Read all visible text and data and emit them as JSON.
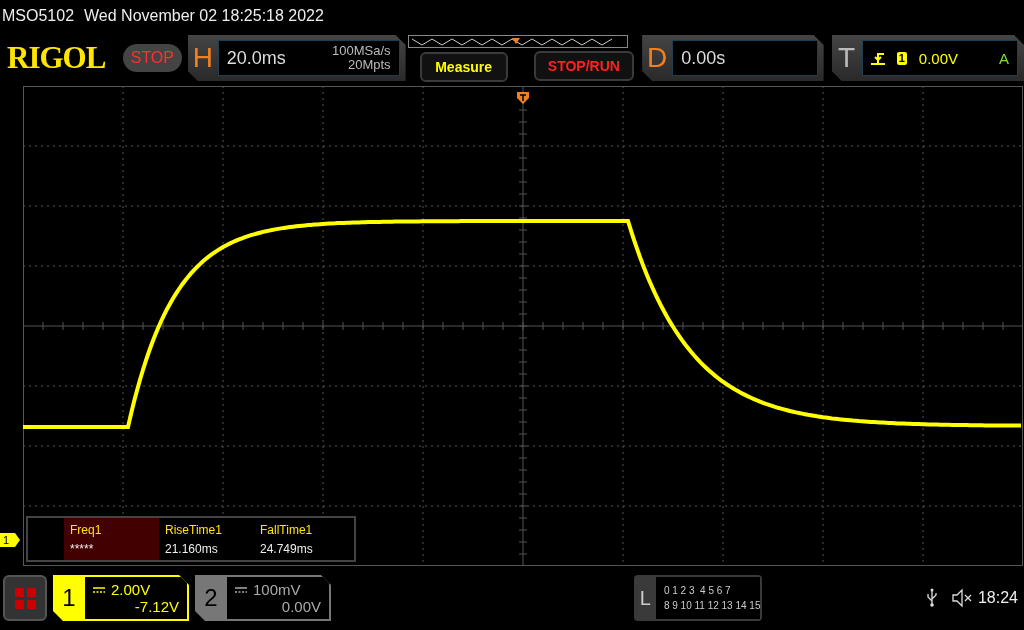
{
  "title_bar": {
    "model": "MSO5102",
    "datetime": "Wed November 02 18:25:18 2022"
  },
  "toolbar": {
    "logo": "RIGOL",
    "run_state": {
      "text": "STOP",
      "running": false
    },
    "horizontal": {
      "label": "H",
      "timebase": "20.0ms",
      "sample_rate": "100MSa/s",
      "memory_depth": "20Mpts"
    },
    "measure_button": "Measure",
    "stop_run_button": "STOP/RUN",
    "delay": {
      "label": "D",
      "value": "0.00s"
    },
    "trigger": {
      "label": "T",
      "source": "1",
      "level": "0.00V",
      "mode": "A"
    }
  },
  "display": {
    "channel_marker": "1",
    "measurements": [
      {
        "name": "Freq1",
        "value": "*****",
        "selected": true
      },
      {
        "name": "RiseTime1",
        "value": "21.160ms",
        "selected": false
      },
      {
        "name": "FallTime1",
        "value": "24.749ms",
        "selected": false
      }
    ]
  },
  "status_bar": {
    "channels": [
      {
        "number": "1",
        "scale": "2.00V",
        "offset": "-7.12V",
        "selected": true
      },
      {
        "number": "2",
        "scale": "100mV",
        "offset": "0.00V",
        "selected": false
      }
    ],
    "logic": {
      "label": "L",
      "rows": [
        "0 1 2 3  4 5 6 7",
        "8 9 10 11 12 13 14 15"
      ]
    },
    "time": "18:24"
  }
}
